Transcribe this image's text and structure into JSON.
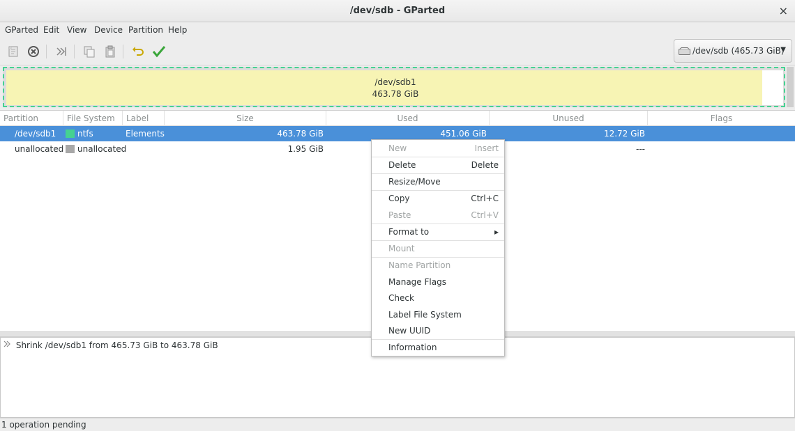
{
  "window": {
    "title": "/dev/sdb - GParted",
    "close_glyph": "×"
  },
  "menubar": [
    "GParted",
    "Edit",
    "View",
    "Device",
    "Partition",
    "Help"
  ],
  "device_selector": {
    "label": "/dev/sdb  (465.73 GiB)",
    "arrow": "▼"
  },
  "disk_map": {
    "partition": "/dev/sdb1",
    "size": "463.78 GiB"
  },
  "table": {
    "columns": [
      "Partition",
      "File System",
      "Label",
      "Size",
      "Used",
      "Unused",
      "Flags"
    ],
    "rows": [
      {
        "partition": "/dev/sdb1",
        "fs": "ntfs",
        "fs_color": "#45d291",
        "label": "Elements",
        "size": "463.78 GiB",
        "used": "451.06 GiB",
        "unused": "12.72 GiB",
        "flags": ""
      },
      {
        "partition": "unallocated",
        "fs": "unallocated",
        "fs_color": "#a8a8a8",
        "label": "",
        "size": "1.95 GiB",
        "used": "",
        "unused": "---",
        "flags": ""
      }
    ]
  },
  "context_menu": {
    "items": [
      {
        "label": "New",
        "accel": "Insert",
        "disabled": true
      },
      {
        "label": "Delete",
        "accel": "Delete",
        "disabled": false
      },
      {
        "label": "Resize/Move",
        "accel": "",
        "disabled": false
      },
      {
        "label": "Copy",
        "accel": "Ctrl+C",
        "disabled": false
      },
      {
        "label": "Paste",
        "accel": "Ctrl+V",
        "disabled": true
      },
      {
        "label": "Format to",
        "accel": "▸",
        "disabled": false
      },
      {
        "label": "Mount",
        "accel": "",
        "disabled": true
      },
      {
        "label": "Name Partition",
        "accel": "",
        "disabled": true
      },
      {
        "label": "Manage Flags",
        "accel": "",
        "disabled": false
      },
      {
        "label": "Check",
        "accel": "",
        "disabled": false
      },
      {
        "label": "Label File System",
        "accel": "",
        "disabled": false
      },
      {
        "label": "New UUID",
        "accel": "",
        "disabled": false
      },
      {
        "label": "Information",
        "accel": "",
        "disabled": false
      }
    ]
  },
  "operations": {
    "pending": [
      "Shrink /dev/sdb1 from 465.73 GiB to 463.78 GiB"
    ]
  },
  "status": "1 operation pending",
  "colors": {
    "selection": "#4a90d9",
    "ntfs": "#45d291",
    "used_fill": "#f7f4b4",
    "unallocated": "#a8a8a8"
  }
}
